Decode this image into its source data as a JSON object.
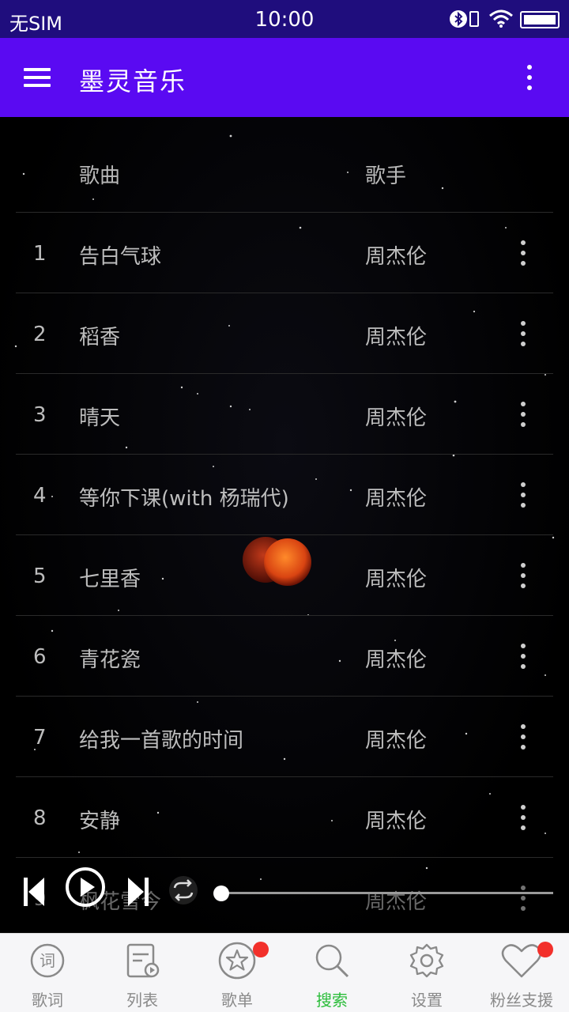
{
  "status_bar": {
    "carrier": "无SIM",
    "time": "10:00",
    "icons": [
      "bluetooth-icon",
      "sim-icon",
      "wifi-icon",
      "battery-icon"
    ]
  },
  "app_bar": {
    "title": "墨灵音乐",
    "menu_icon": "hamburger-menu-icon",
    "overflow_icon": "more-vertical-icon"
  },
  "table": {
    "header": {
      "song": "歌曲",
      "singer": "歌手"
    },
    "rows": [
      {
        "num": "1",
        "song": "告白气球",
        "singer": "周杰伦"
      },
      {
        "num": "2",
        "song": "稻香",
        "singer": "周杰伦"
      },
      {
        "num": "3",
        "song": "晴天",
        "singer": "周杰伦"
      },
      {
        "num": "4",
        "song": "等你下课(with 杨瑞代)",
        "singer": "周杰伦"
      },
      {
        "num": "5",
        "song": "七里香",
        "singer": "周杰伦"
      },
      {
        "num": "6",
        "song": "青花瓷",
        "singer": "周杰伦"
      },
      {
        "num": "7",
        "song": "给我一首歌的时间",
        "singer": "周杰伦"
      },
      {
        "num": "8",
        "song": "安静",
        "singer": "周杰伦"
      },
      {
        "num": "9",
        "song": "枫花雪今",
        "singer": "周杰伦"
      }
    ]
  },
  "player": {
    "icons": [
      "skip-previous-icon",
      "play-icon",
      "skip-next-icon",
      "repeat-icon"
    ],
    "progress": 0
  },
  "bottom_nav": {
    "items": [
      {
        "label": "歌词",
        "icon": "lyrics-icon",
        "active": false,
        "badge": false
      },
      {
        "label": "列表",
        "icon": "list-icon",
        "active": false,
        "badge": false
      },
      {
        "label": "歌单",
        "icon": "star-icon",
        "active": false,
        "badge": true
      },
      {
        "label": "搜索",
        "icon": "search-icon",
        "active": true,
        "badge": false
      },
      {
        "label": "设置",
        "icon": "gear-icon",
        "active": false,
        "badge": false
      },
      {
        "label": "粉丝支援",
        "icon": "heart-icon",
        "active": false,
        "badge": true
      }
    ]
  },
  "colors": {
    "status_bar": "#1f0d7d",
    "app_bar": "#5a0af2",
    "active_tab": "#2bbd3a",
    "badge": "#f2302b"
  }
}
